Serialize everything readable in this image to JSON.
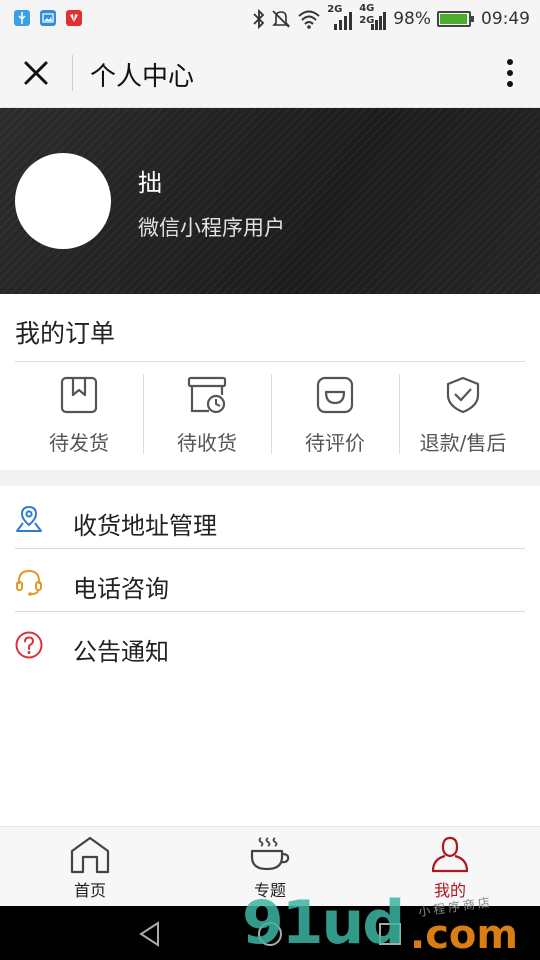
{
  "status_bar": {
    "network_labels": [
      "2G",
      "4G",
      "2G"
    ],
    "battery_level": 98,
    "battery_text": "98%",
    "time": "09:49"
  },
  "nav": {
    "title": "个人中心",
    "close_icon": "close-icon",
    "more_icon": "more-vertical-icon"
  },
  "profile": {
    "nickname": "拙",
    "user_type": "微信小程序用户"
  },
  "orders": {
    "title": "我的订单",
    "items": [
      {
        "label": "待发货",
        "icon": "box-icon"
      },
      {
        "label": "待收货",
        "icon": "delivery-clock-icon"
      },
      {
        "label": "待评价",
        "icon": "smile-icon"
      },
      {
        "label": "退款/售后",
        "icon": "shield-check-icon"
      }
    ]
  },
  "menu": {
    "items": [
      {
        "label": "收货地址管理",
        "icon": "location-pin-icon",
        "color": "#2e7bcf"
      },
      {
        "label": "电话咨询",
        "icon": "headset-icon",
        "color": "#e39a2a"
      },
      {
        "label": "公告通知",
        "icon": "question-circle-icon",
        "color": "#d9323a"
      }
    ]
  },
  "tab_bar": {
    "tabs": [
      {
        "label": "首页",
        "icon": "home-icon"
      },
      {
        "label": "专题",
        "icon": "coffee-cup-icon"
      },
      {
        "label": "我的",
        "icon": "user-icon",
        "active": true
      }
    ],
    "active_color": "#b0161c"
  },
  "watermark": {
    "brand": "91ud",
    "suffix": ".com",
    "small": "小程序商店"
  }
}
